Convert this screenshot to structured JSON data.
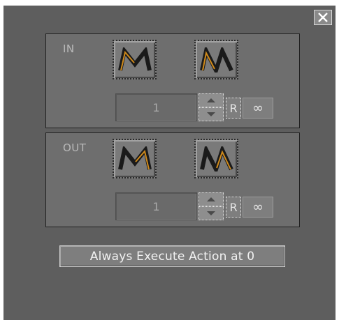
{
  "window": {
    "close_icon": "close-x-icon",
    "background": "#5e5e5e"
  },
  "in_group": {
    "label": "IN",
    "modes": [
      {
        "icon": "ease-in-out-icon",
        "selected": true
      },
      {
        "icon": "ease-zigzag-icon",
        "selected": false
      }
    ],
    "count_value": "1",
    "reset_label": "R",
    "infinite_label": "∞"
  },
  "out_group": {
    "label": "OUT",
    "modes": [
      {
        "icon": "ease-in-out-icon",
        "selected": true
      },
      {
        "icon": "ease-zigzag-icon",
        "selected": false
      }
    ],
    "count_value": "1",
    "reset_label": "R",
    "infinite_label": "∞"
  },
  "actions": {
    "always_execute_label": "Always Execute Action at 0"
  },
  "colors": {
    "accent_orange": "#d08a1a",
    "glyph_dark": "#1a1a1a"
  }
}
